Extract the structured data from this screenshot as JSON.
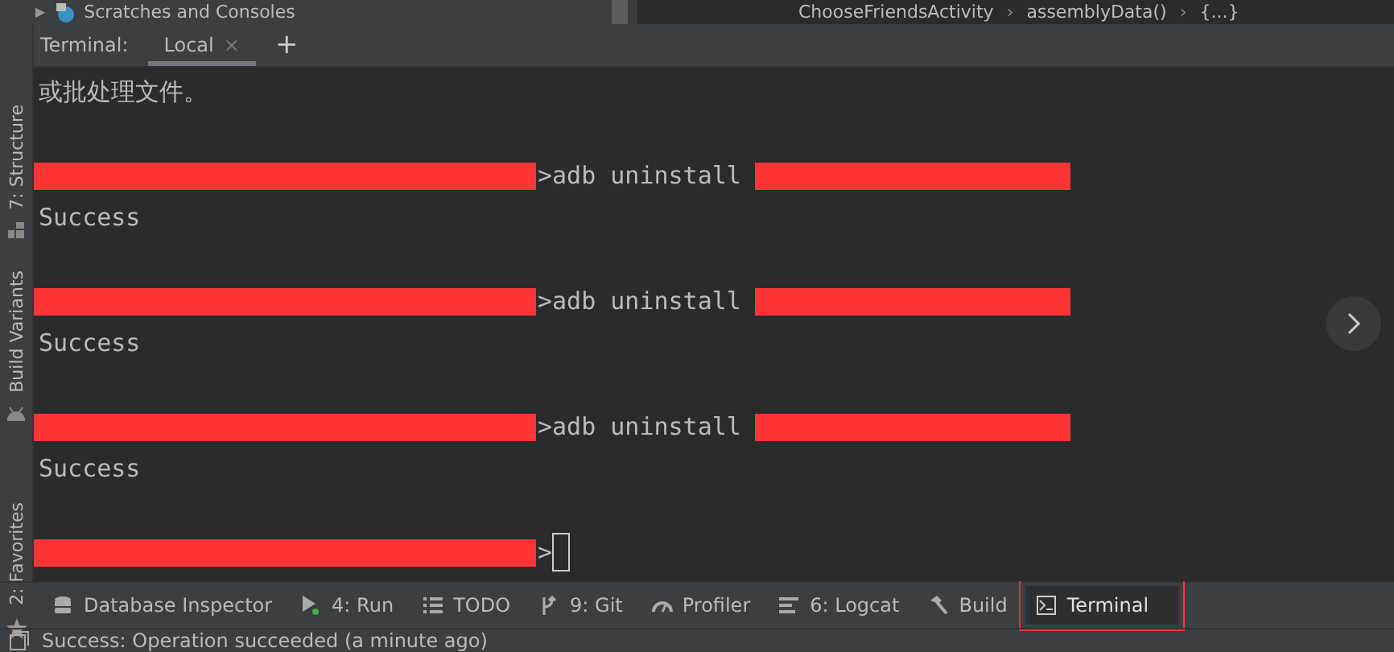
{
  "top_bar": {
    "tree_arrow": "▶",
    "project_item": "Scratches and Consoles",
    "breadcrumbs": [
      {
        "label": "ChooseFriendsActivity"
      },
      {
        "separator": "›",
        "label": "assemblyData()"
      },
      {
        "separator": "›",
        "label": "{...}"
      }
    ]
  },
  "side_tools": [
    {
      "label": "7: Structure"
    },
    {
      "label": "Build Variants"
    },
    {
      "label": "2: Favorites"
    }
  ],
  "terminal": {
    "title": "Terminal:",
    "tabs": [
      {
        "label": "Local",
        "selected": true,
        "close": "×"
      }
    ],
    "add": "+",
    "lines": [
      {
        "kind": "output",
        "text": "或批处理文件。"
      },
      {
        "kind": "blank"
      },
      {
        "kind": "prompt",
        "text": ">adb uninstall ",
        "redacted_after": true,
        "cursor": false
      },
      {
        "kind": "output",
        "text": "Success"
      },
      {
        "kind": "blank"
      },
      {
        "kind": "prompt",
        "text": ">adb uninstall ",
        "redacted_after": true,
        "cursor": false
      },
      {
        "kind": "output",
        "text": "Success"
      },
      {
        "kind": "blank"
      },
      {
        "kind": "prompt",
        "text": ">adb uninstall ",
        "redacted_after": true,
        "cursor": false
      },
      {
        "kind": "output",
        "text": "Success"
      },
      {
        "kind": "blank"
      },
      {
        "kind": "prompt",
        "text": ">",
        "redacted_after": false,
        "cursor": true
      }
    ]
  },
  "tool_windows": [
    {
      "label": "Database Inspector",
      "selected": false,
      "highlighted": false
    },
    {
      "label": "4: Run",
      "selected": false,
      "highlighted": false
    },
    {
      "label": "TODO",
      "selected": false,
      "highlighted": false
    },
    {
      "label": "9: Git",
      "selected": false,
      "highlighted": false
    },
    {
      "label": "Profiler",
      "selected": false,
      "highlighted": false
    },
    {
      "label": "6: Logcat",
      "selected": false,
      "highlighted": false
    },
    {
      "label": "Build",
      "selected": false,
      "highlighted": false
    },
    {
      "label": "Terminal",
      "selected": true,
      "highlighted": true
    }
  ],
  "status_bar": {
    "message": "Success: Operation succeeded (a minute ago)"
  }
}
